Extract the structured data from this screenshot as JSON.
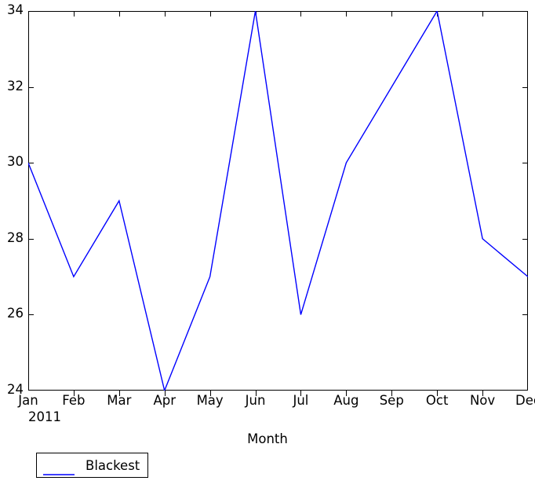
{
  "chart_data": {
    "type": "line",
    "title": "",
    "xlabel": "Month",
    "ylabel": "",
    "categories": [
      "Jan",
      "Feb",
      "Mar",
      "Apr",
      "May",
      "Jun",
      "Jul",
      "Aug",
      "Sep",
      "Oct",
      "Nov",
      "Dec"
    ],
    "x_axis_subtitle": "2011",
    "xtick_labels": [
      "Jan",
      "Feb",
      "Mar",
      "Apr",
      "May",
      "Jun",
      "Jul",
      "Aug",
      "Sep",
      "Oct",
      "Nov",
      "Dec"
    ],
    "ytick_labels": [
      "24",
      "26",
      "28",
      "30",
      "32",
      "34"
    ],
    "ytick_values": [
      24,
      26,
      28,
      30,
      32,
      34
    ],
    "ylim": [
      24,
      34
    ],
    "xlim": [
      0,
      11
    ],
    "grid": false,
    "legend_position": "below-left",
    "series": [
      {
        "name": "Blackest",
        "color": "#0000ff",
        "values": [
          30,
          27,
          29,
          24,
          27,
          34,
          26,
          30,
          32,
          34,
          28,
          27
        ]
      }
    ]
  },
  "legend": {
    "entries": [
      {
        "label": "Blackest",
        "color": "#0000ff"
      }
    ]
  },
  "axes": {
    "x_label": "Month",
    "x_year": "2011"
  },
  "colors": {
    "line": "#0000ff",
    "axis": "#000000",
    "background": "#ffffff"
  }
}
